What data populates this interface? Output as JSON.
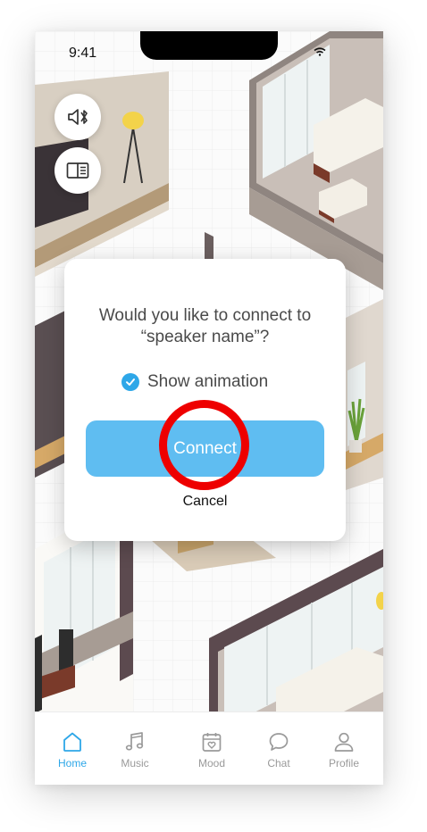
{
  "status_bar": {
    "time": "9:41"
  },
  "floating_buttons": [
    {
      "icon": "speaker-bluetooth-icon"
    },
    {
      "icon": "layout-panel-icon"
    }
  ],
  "dialog": {
    "message": "Would you like to connect to “speaker name”?",
    "show_animation_label": "Show animation",
    "show_animation_checked": true,
    "connect_label": "Connect",
    "cancel_label": "Cancel"
  },
  "tab_bar": {
    "items": [
      {
        "label": "Home",
        "icon": "home-icon",
        "active": true
      },
      {
        "label": "Music",
        "icon": "music-icon",
        "active": false
      },
      {
        "label": "Mood",
        "icon": "calendar-heart-icon",
        "active": false
      },
      {
        "label": "Chat",
        "icon": "chat-bubble-icon",
        "active": false
      },
      {
        "label": "Profile",
        "icon": "profile-icon",
        "active": false
      }
    ]
  },
  "colors": {
    "accent": "#2ea7e8",
    "connect_button": "#5fbdf1",
    "annotation": "#ee0000"
  }
}
